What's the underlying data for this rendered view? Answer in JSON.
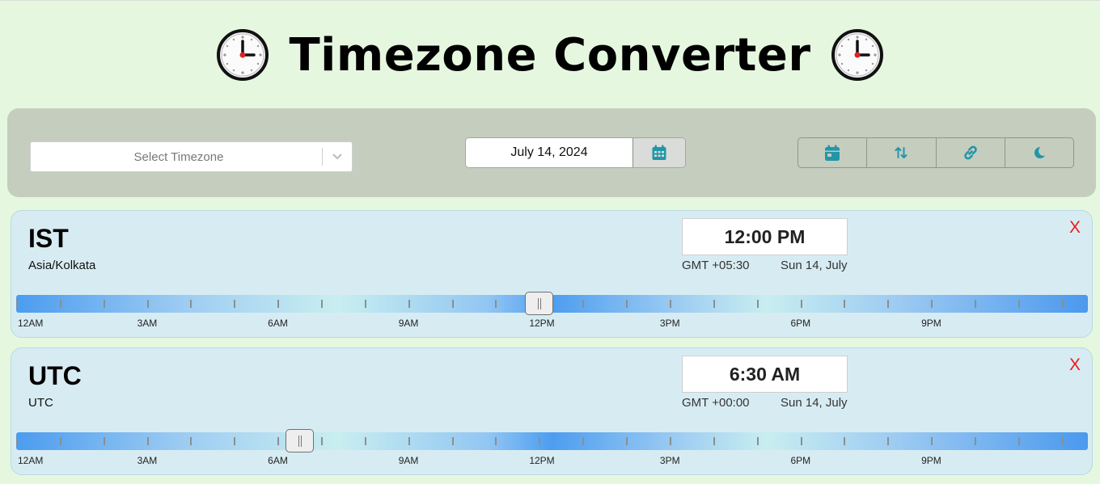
{
  "app": {
    "title": "Timezone Converter",
    "title_icon": "clock-icon"
  },
  "toolbar": {
    "timezone_select": {
      "placeholder": "Select Timezone",
      "selected": ""
    },
    "date": {
      "value": "July 14, 2024",
      "icon": "calendar-icon"
    },
    "actions": [
      {
        "name": "schedule-button",
        "icon": "calendar-day-icon"
      },
      {
        "name": "swap-order-button",
        "icon": "sort-arrows-icon"
      },
      {
        "name": "copy-link-button",
        "icon": "link-icon"
      },
      {
        "name": "dark-mode-button",
        "icon": "moon-icon"
      }
    ],
    "accent": "#2196a8"
  },
  "timeline_labels": [
    "12AM",
    "3AM",
    "6AM",
    "9AM",
    "12PM",
    "3PM",
    "6PM",
    "9PM"
  ],
  "cards": [
    {
      "abbr": "IST",
      "zone": "Asia/Kolkata",
      "time": "12:00 PM",
      "offset": "GMT +05:30",
      "day": "Sun 14, July",
      "close": "X",
      "slider_hour": 12
    },
    {
      "abbr": "UTC",
      "zone": "UTC",
      "time": "6:30 AM",
      "offset": "GMT +00:00",
      "day": "Sun 14, July",
      "close": "X",
      "slider_hour": 6.5
    }
  ],
  "colors": {
    "background": "#e6f7e0",
    "toolbar": "#c5cdbf",
    "card": "#d7ecf2",
    "close": "#f01818"
  }
}
